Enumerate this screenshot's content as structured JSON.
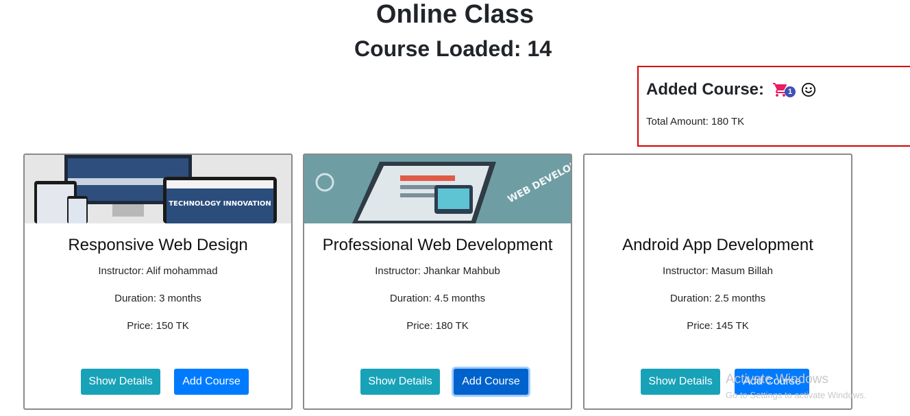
{
  "header": {
    "title": "Online Class",
    "subtitle": "Course Loaded: 14"
  },
  "cart": {
    "heading": "Added Course:",
    "count": "1",
    "cart_icon": "shopping-cart-icon",
    "smile_icon": "smiley-face-icon",
    "total": "Total Amount: 180 TK",
    "accent_color": "#e91e63",
    "border_color": "#d40000"
  },
  "courses": [
    {
      "title": "Responsive Web Design",
      "instructor": "Instructor: Alif mohammad",
      "duration": "Duration: 3 months",
      "price": "Price: 150 TK",
      "details_label": "Show Details",
      "add_label": "Add Course",
      "image_caption": "TECHNOLOGY INNOVATION"
    },
    {
      "title": "Professional Web Development",
      "instructor": "Instructor: Jhankar Mahbub",
      "duration": "Duration: 4.5 months",
      "price": "Price: 180 TK",
      "details_label": "Show Details",
      "add_label": "Add Course",
      "image_caption": "WEB DEVELOPMENT"
    },
    {
      "title": "Android App Development",
      "instructor": "Instructor: Masum Billah",
      "duration": "Duration: 2.5 months",
      "price": "Price: 145 TK",
      "details_label": "Show Details",
      "add_label": "Add Course"
    }
  ],
  "watermark": {
    "line1": "Activate Windows",
    "line2": "Go to Settings to activate Windows."
  },
  "colors": {
    "details_button": "#17a2b8",
    "add_button": "#007bff"
  }
}
